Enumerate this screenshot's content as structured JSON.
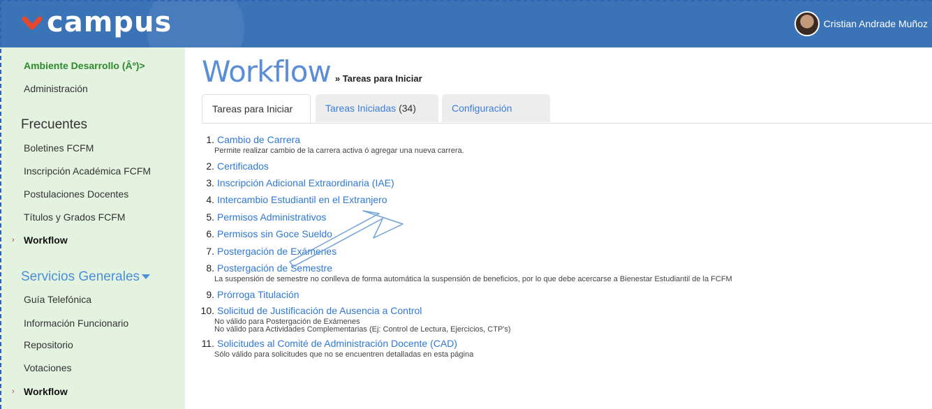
{
  "header": {
    "logo_text": "campus",
    "user_name": "Cristian Andrade Muñoz"
  },
  "sidebar": {
    "environment": "Ambiente Desarrollo (Âº)>",
    "admin": "Administración",
    "frecuentes_heading": "Frecuentes",
    "frecuentes": [
      "Boletines FCFM",
      "Inscripción Académica FCFM",
      "Postulaciones Docentes",
      "Títulos y Grados FCFM",
      "Workflow"
    ],
    "servicios_heading": "Servicios Generales",
    "servicios": [
      "Guía Telefónica",
      "Información Funcionario",
      "Repositorio",
      "Votaciones",
      "Workflow"
    ]
  },
  "main": {
    "title": "Workflow",
    "subtitle": "» Tareas para Iniciar",
    "tabs": [
      {
        "label": "Tareas para Iniciar"
      },
      {
        "label": "Tareas Iniciadas",
        "count": "(34)"
      },
      {
        "label": "Configuración"
      }
    ],
    "tasks": [
      {
        "num": "1.",
        "label": "Cambio de Carrera",
        "desc": [
          "Permite realizar cambio de la carrera activa ó agregar una nueva carrera."
        ]
      },
      {
        "num": "2.",
        "label": "Certificados",
        "desc": []
      },
      {
        "num": "3.",
        "label": "Inscripción Adicional Extraordinaria (IAE)",
        "desc": []
      },
      {
        "num": "4.",
        "label": "Intercambio Estudiantil en el Extranjero",
        "desc": []
      },
      {
        "num": "5.",
        "label": "Permisos Administrativos",
        "desc": []
      },
      {
        "num": "6.",
        "label": "Permisos sin Goce Sueldo",
        "desc": []
      },
      {
        "num": "7.",
        "label": "Postergación de Exámenes",
        "desc": []
      },
      {
        "num": "8.",
        "label": "Postergación de Semestre",
        "desc": [
          "La suspensión de semestre no conlleva de forma automática la suspensión de beneficios, por lo que debe acercarse a Bienestar Estudiantil de la FCFM"
        ]
      },
      {
        "num": "9.",
        "label": "Prórroga Titulación",
        "desc": []
      },
      {
        "num": "10.",
        "label": "Solicitud de Justificación de Ausencia a Control",
        "desc": [
          "No válido para Postergación de Exámenes",
          "No válido para Actividades Complementarias (Ej: Control de Lectura, Ejercicios, CTP's)"
        ]
      },
      {
        "num": "11.",
        "label": "Solicitudes al Comité de Administración Docente (CAD)",
        "desc": [
          "Sólo válido para solicitudes que no se encuentren detalladas en esta página"
        ]
      }
    ]
  },
  "colors": {
    "header": "#3b73b7",
    "sidebar": "#e4f2e0",
    "link": "#2f78d3",
    "env_green": "#2c8a2c",
    "logo_accent": "#e8472a"
  },
  "icons": [
    "campus-logo-icon",
    "user-avatar",
    "chevron-down-icon",
    "active-arrow-icon",
    "annotation-arrow"
  ]
}
